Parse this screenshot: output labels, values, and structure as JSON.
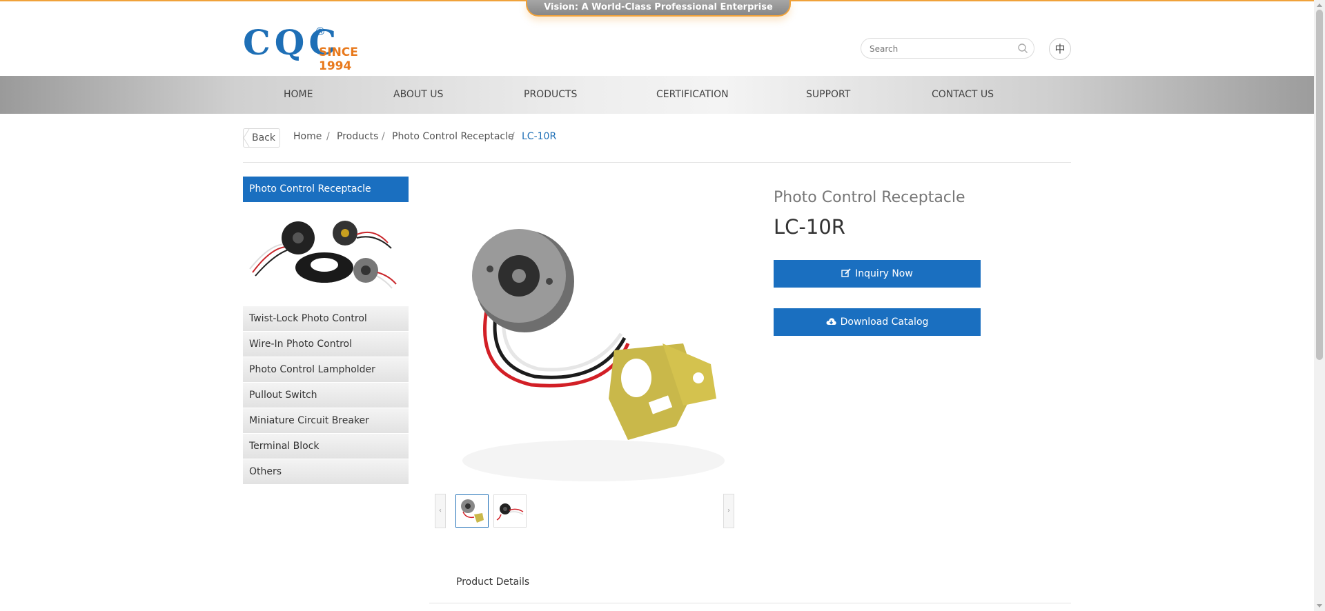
{
  "header": {
    "vision_text": "Vision: A World-Class Professional Enterprise",
    "logo_text": "CQC",
    "logo_reg": "®",
    "logo_since": "SINCE 1994",
    "search_placeholder": "Search",
    "lang_label": "中"
  },
  "nav": {
    "items": [
      {
        "label": "HOME"
      },
      {
        "label": "ABOUT US"
      },
      {
        "label": "PRODUCTS"
      },
      {
        "label": "CERTIFICATION"
      },
      {
        "label": "SUPPORT"
      },
      {
        "label": "CONTACT US"
      }
    ]
  },
  "breadcrumb": {
    "back": "Back",
    "items": [
      "Home",
      "Products",
      "Photo Control Receptacle",
      "LC-10R"
    ],
    "separator": "/"
  },
  "sidebar": {
    "title": "Photo Control Receptacle",
    "items": [
      {
        "label": "Twist-Lock Photo Control"
      },
      {
        "label": "Wire-In Photo Control"
      },
      {
        "label": "Photo Control Lampholder"
      },
      {
        "label": "Pullout Switch"
      },
      {
        "label": "Miniature Circuit Breaker"
      },
      {
        "label": "Terminal Block"
      },
      {
        "label": "Others"
      }
    ]
  },
  "product": {
    "category": "Photo Control Receptacle",
    "model": "LC-10R",
    "inquiry_label": "Inquiry Now",
    "catalog_label": "Download Catalog",
    "details_tab": "Product Details"
  },
  "colors": {
    "accent": "#1a6fc0",
    "orange": "#f0a23a",
    "logo_orange": "#e8791c"
  }
}
